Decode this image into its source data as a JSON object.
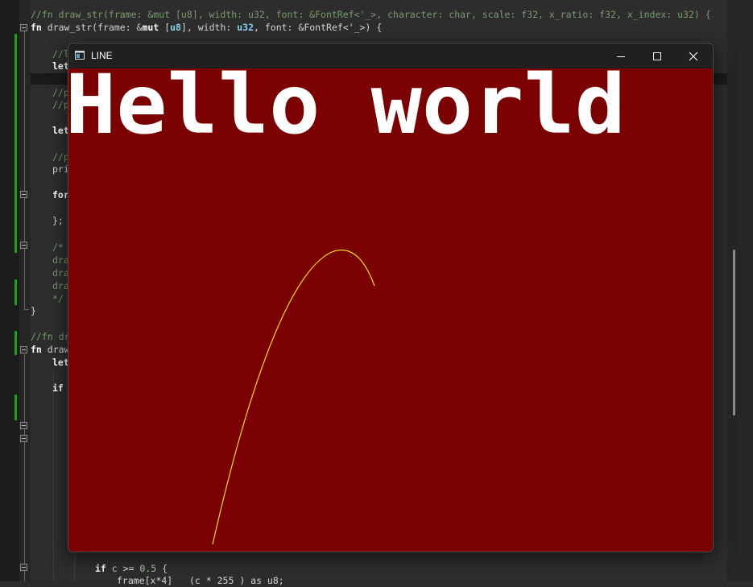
{
  "window": {
    "title": "LINE",
    "canvas_text": "Hello world",
    "canvas_bg": "#7b0000",
    "text_color": "#ffffff",
    "curve_color": "#e8e000",
    "icons": {
      "app": "window-app-icon",
      "minimize": "minimize-icon",
      "maximize": "maximize-icon",
      "close": "close-icon"
    }
  },
  "editor": {
    "lines": {
      "l1": "//fn draw_str(frame: &mut [u8], width: u32, font: &FontRef<'_>, character: char, scale: f32, x_ratio: f32, x_index: u32) {",
      "l2_kw": "fn",
      "l2_a": " draw_str(frame: &",
      "l2_mut": "mut",
      "l2_b": " [",
      "l2_u8": "u8",
      "l2_c": "], width: ",
      "l2_u32": "u32",
      "l2_d": ", font: &FontRef<'_>) {",
      "l3": "//l",
      "l4": "let",
      "l5": "//p",
      "l6": "//p",
      "l7": "let",
      "l8": "//p",
      "l9": "pri",
      "l10": "for",
      "l11": "};",
      "l12": "/*",
      "l13": "dra",
      "l14": "dra",
      "l15": "dra",
      "l16": "*/",
      "l17": "}",
      "l18": "//fn dr",
      "l19_kw": "fn",
      "l19": " draw",
      "l20": "let",
      "l21": "if",
      "l22_kw": "if",
      "l22_a": " c ",
      "l22_op": ">=",
      "l22_num": " 0.5",
      "l22_b": " {",
      "l23": "frame[x*4]   (c * 255 ) as u8;"
    }
  }
}
